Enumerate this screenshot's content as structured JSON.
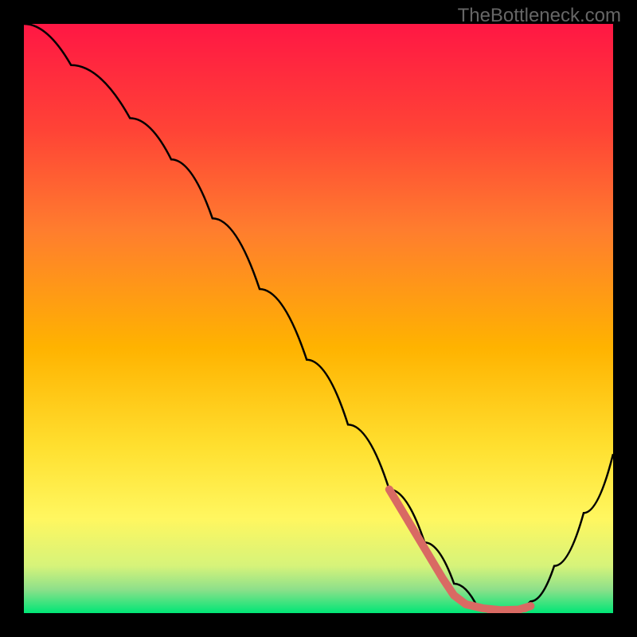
{
  "watermark": "TheBottleneck.com",
  "chart_data": {
    "type": "line",
    "title": "",
    "xlabel": "",
    "ylabel": "",
    "xlim": [
      0,
      100
    ],
    "ylim": [
      0,
      100
    ],
    "gradient_stops": [
      {
        "offset": 0,
        "color": "#ff1744"
      },
      {
        "offset": 18,
        "color": "#ff4336"
      },
      {
        "offset": 35,
        "color": "#ff7d2e"
      },
      {
        "offset": 55,
        "color": "#ffb300"
      },
      {
        "offset": 72,
        "color": "#ffe030"
      },
      {
        "offset": 84,
        "color": "#fff760"
      },
      {
        "offset": 92,
        "color": "#d6f37a"
      },
      {
        "offset": 96,
        "color": "#8de08a"
      },
      {
        "offset": 100,
        "color": "#00e676"
      }
    ],
    "series": [
      {
        "name": "bottleneck-curve",
        "color": "#000000",
        "points": [
          {
            "x": 0,
            "y": 100
          },
          {
            "x": 8,
            "y": 93
          },
          {
            "x": 18,
            "y": 84
          },
          {
            "x": 25,
            "y": 77
          },
          {
            "x": 32,
            "y": 67
          },
          {
            "x": 40,
            "y": 55
          },
          {
            "x": 48,
            "y": 43
          },
          {
            "x": 55,
            "y": 32
          },
          {
            "x": 62,
            "y": 21
          },
          {
            "x": 68,
            "y": 12
          },
          {
            "x": 73,
            "y": 5
          },
          {
            "x": 77,
            "y": 1
          },
          {
            "x": 82,
            "y": 0
          },
          {
            "x": 86,
            "y": 2
          },
          {
            "x": 90,
            "y": 8
          },
          {
            "x": 95,
            "y": 17
          },
          {
            "x": 100,
            "y": 27
          }
        ]
      },
      {
        "name": "highlight-segment",
        "color": "#d96a63",
        "stroke_width": 10,
        "points": [
          {
            "x": 62,
            "y": 21
          },
          {
            "x": 65,
            "y": 16
          },
          {
            "x": 68,
            "y": 11
          },
          {
            "x": 71,
            "y": 6
          },
          {
            "x": 73,
            "y": 3
          },
          {
            "x": 75,
            "y": 1.5
          },
          {
            "x": 78,
            "y": 0.8
          },
          {
            "x": 81,
            "y": 0.5
          },
          {
            "x": 84,
            "y": 0.6
          },
          {
            "x": 86,
            "y": 1.2
          }
        ]
      }
    ]
  }
}
